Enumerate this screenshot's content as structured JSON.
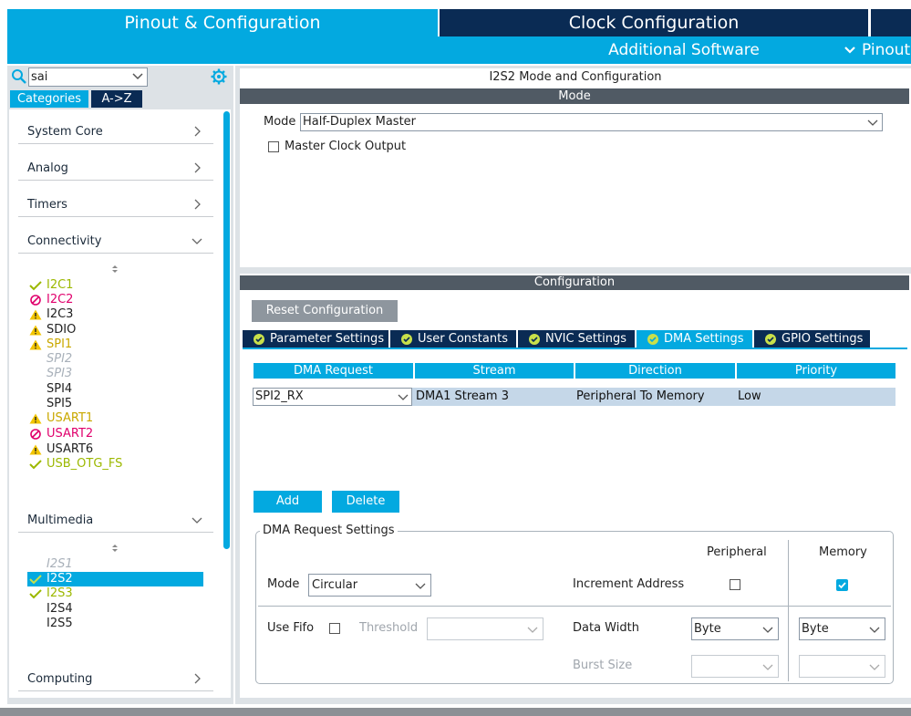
{
  "top_tabs": {
    "pinout": "Pinout & Configuration",
    "clock": "Clock Configuration",
    "additional": "Additional Software",
    "pinout_menu": "Pinout"
  },
  "search": {
    "value": "sai"
  },
  "left": {
    "categories_label": "Categories",
    "atoz_label": "A->Z",
    "categories": [
      {
        "label": "System Core"
      },
      {
        "label": "Analog"
      },
      {
        "label": "Timers"
      },
      {
        "label": "Connectivity"
      },
      {
        "label": "Multimedia"
      },
      {
        "label": "Computing"
      }
    ],
    "connectivity_items": [
      {
        "label": "I2C1",
        "status": "ok"
      },
      {
        "label": "I2C2",
        "status": "error"
      },
      {
        "label": "I2C3",
        "status": "warning"
      },
      {
        "label": "SDIO",
        "status": "warning"
      },
      {
        "label": "SPI1",
        "status": "warning"
      },
      {
        "label": "SPI2",
        "status": "disabled"
      },
      {
        "label": "SPI3",
        "status": "disabled"
      },
      {
        "label": "SPI4",
        "status": "none"
      },
      {
        "label": "SPI5",
        "status": "none"
      },
      {
        "label": "USART1",
        "status": "warning"
      },
      {
        "label": "USART2",
        "status": "error"
      },
      {
        "label": "USART6",
        "status": "warning"
      },
      {
        "label": "USB_OTG_FS",
        "status": "ok"
      }
    ],
    "multimedia_items": [
      {
        "label": "I2S1",
        "status": "disabled"
      },
      {
        "label": "I2S2",
        "status": "selected"
      },
      {
        "label": "I2S3",
        "status": "ok"
      },
      {
        "label": "I2S4",
        "status": "none"
      },
      {
        "label": "I2S5",
        "status": "none"
      }
    ]
  },
  "mode_panel": {
    "title": "I2S2 Mode and Configuration",
    "header": "Mode",
    "mode_label": "Mode",
    "mode_value": "Half-Duplex Master",
    "master_clock_label": "Master Clock Output"
  },
  "config_panel": {
    "header": "Configuration",
    "reset_label": "Reset Configuration",
    "tabs": [
      {
        "label": "Parameter Settings"
      },
      {
        "label": "User Constants"
      },
      {
        "label": "NVIC Settings"
      },
      {
        "label": "DMA Settings"
      },
      {
        "label": "GPIO Settings"
      }
    ],
    "active_tab": "DMA Settings"
  },
  "dma_table": {
    "headers": [
      "DMA Request",
      "Stream",
      "Direction",
      "Priority"
    ],
    "rows": [
      {
        "request": "SPI2_RX",
        "stream": "DMA1 Stream 3",
        "direction": "Peripheral To Memory",
        "priority": "Low"
      }
    ],
    "add_label": "Add",
    "delete_label": "Delete"
  },
  "dma_request_settings": {
    "legend": "DMA Request Settings",
    "peripheral_label": "Peripheral",
    "memory_label": "Memory",
    "mode_label": "Mode",
    "mode_value": "Circular",
    "increment_label": "Increment Address",
    "peripheral_increment": false,
    "memory_increment": true,
    "use_fifo_label": "Use Fifo",
    "threshold_label": "Threshold",
    "data_width_label": "Data Width",
    "data_width_peripheral": "Byte",
    "data_width_memory": "Byte",
    "burst_size_label": "Burst Size"
  },
  "colors": {
    "accent": "#03a9e0",
    "dark": "#0a2b54",
    "ok": "#9cb800",
    "error": "#e0006c",
    "warning": "#f2c500"
  }
}
